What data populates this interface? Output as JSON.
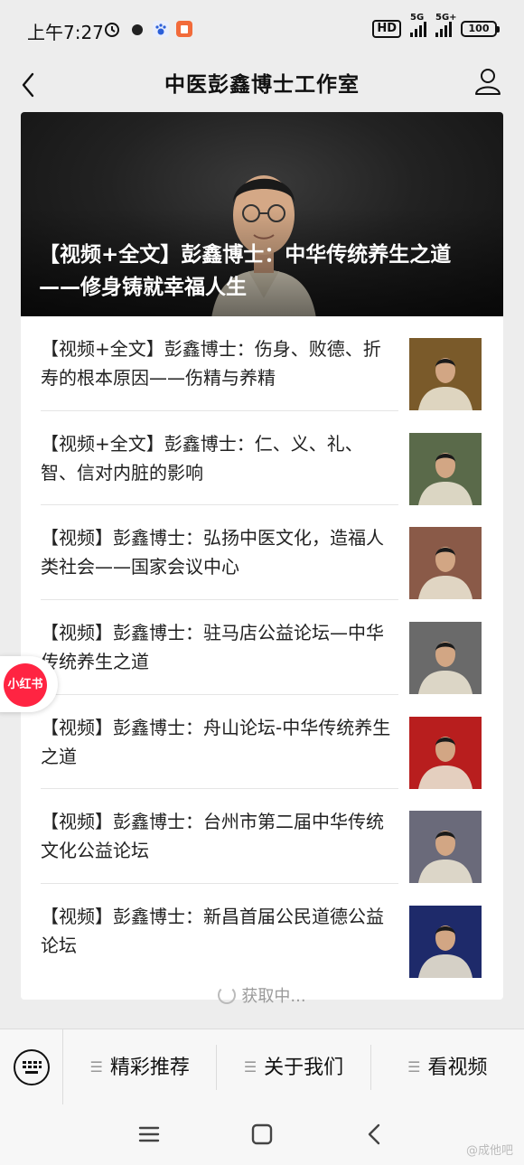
{
  "status_bar": {
    "time": "上午7:27",
    "hd": "HD",
    "net1": "5G",
    "net2": "5G+",
    "battery": "100"
  },
  "header": {
    "title": "中医彭鑫博士工作室"
  },
  "hero": {
    "title": "【视频+全文】彭鑫博士：中华传统养生之道——修身铸就幸福人生"
  },
  "articles": [
    {
      "title": "【视频+全文】彭鑫博士：伤身、败德、折寿的根本原因——伤精与养精",
      "thumb_bg": "#7a5a2a"
    },
    {
      "title": "【视频+全文】彭鑫博士：仁、义、礼、智、信对内脏的影响",
      "thumb_bg": "#5a6a4a"
    },
    {
      "title": "【视频】彭鑫博士：弘扬中医文化，造福人类社会——国家会议中心",
      "thumb_bg": "#8a5a48"
    },
    {
      "title": "【视频】彭鑫博士：驻马店公益论坛—中华传统养生之道",
      "thumb_bg": "#6a6a6a"
    },
    {
      "title": "【视频】彭鑫博士：舟山论坛-中华传统养生之道",
      "thumb_bg": "#b81e1e"
    },
    {
      "title": "【视频】彭鑫博士：台州市第二届中华传统文化公益论坛",
      "thumb_bg": "#6a6a7a"
    },
    {
      "title": "【视频】彭鑫博士：新昌首届公民道德公益论坛",
      "thumb_bg": "#1e2a6a"
    }
  ],
  "loading_text": "获取中...",
  "floating_badge": "小红书",
  "bottom_menu": [
    {
      "label": "精彩推荐"
    },
    {
      "label": "关于我们"
    },
    {
      "label": "看视频"
    }
  ],
  "watermark": "@成他吧",
  "colors": {
    "background": "#ededed",
    "card": "#ffffff",
    "xhs_red": "#ff2442"
  }
}
